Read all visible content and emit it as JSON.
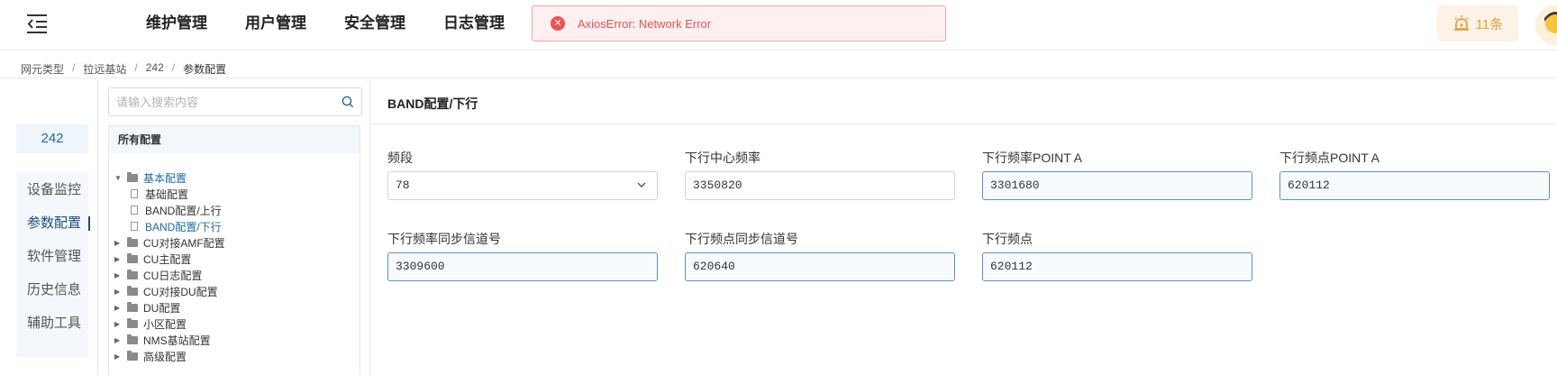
{
  "header": {
    "nav": [
      "维护管理",
      "用户管理",
      "安全管理",
      "日志管理"
    ],
    "error_message": "AxiosError: Network Error",
    "alarm_count": "11条"
  },
  "breadcrumb": [
    "网元类型",
    "拉远基站",
    "242",
    "参数配置"
  ],
  "side": {
    "title": "242",
    "items": [
      "设备监控",
      "参数配置",
      "软件管理",
      "历史信息",
      "辅助工具"
    ],
    "active_index": 1
  },
  "tree": {
    "search_placeholder": "请输入搜索内容",
    "header": "所有配置",
    "nodes": [
      {
        "label": "基本配置",
        "type": "folder",
        "expanded": true
      },
      {
        "label": "基础配置",
        "type": "file"
      },
      {
        "label": "BAND配置/上行",
        "type": "file"
      },
      {
        "label": "BAND配置/下行",
        "type": "file",
        "selected": true
      },
      {
        "label": "CU对接AMF配置",
        "type": "folder"
      },
      {
        "label": "CU主配置",
        "type": "folder"
      },
      {
        "label": "CU日志配置",
        "type": "folder"
      },
      {
        "label": "CU对接DU配置",
        "type": "folder"
      },
      {
        "label": "DU配置",
        "type": "folder"
      },
      {
        "label": "小区配置",
        "type": "folder"
      },
      {
        "label": "NMS基站配置",
        "type": "folder"
      },
      {
        "label": "高级配置",
        "type": "folder"
      }
    ]
  },
  "form": {
    "title": "BAND配置/下行",
    "fields": [
      {
        "label": "频段",
        "value": "78",
        "type": "select"
      },
      {
        "label": "下行中心频率",
        "value": "3350820"
      },
      {
        "label": "下行频率POINT A",
        "value": "3301680"
      },
      {
        "label": "下行频点POINT A",
        "value": "620112"
      },
      {
        "label": "下行频率同步信道号",
        "value": "3309600"
      },
      {
        "label": "下行频点同步信道号",
        "value": "620640"
      },
      {
        "label": "下行频点",
        "value": "620112"
      }
    ]
  },
  "colors": {
    "accent": "#1d6aa8",
    "error": "#f05050",
    "warning": "#e6a23c"
  }
}
